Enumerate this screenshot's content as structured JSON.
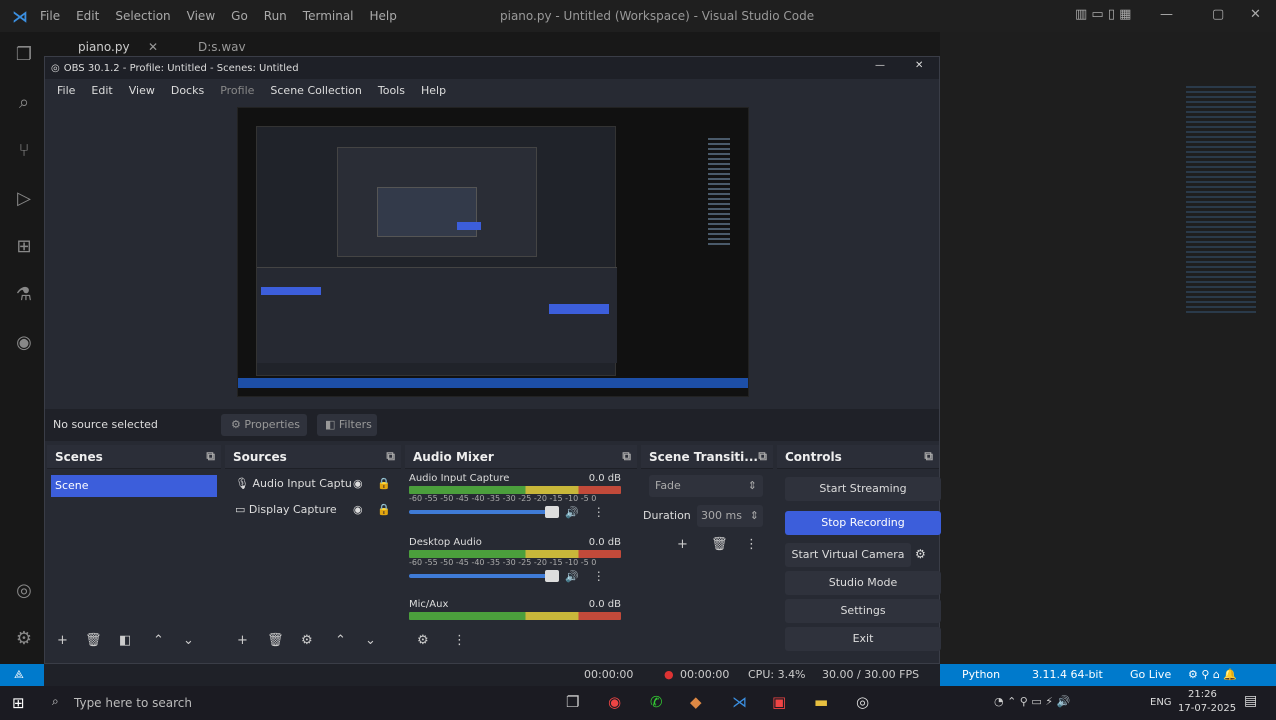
{
  "vscode": {
    "menu": [
      "File",
      "Edit",
      "Selection",
      "View",
      "Go",
      "Run",
      "Terminal",
      "Help"
    ],
    "window_title": "piano.py - Untitled (Workspace) - Visual Studio Code",
    "tabs": [
      "piano.py",
      "D:s.wav"
    ],
    "status": {
      "python": "Python",
      "interpreter": "3.11.4 64-bit",
      "go_live": "Go Live"
    }
  },
  "obs": {
    "title": "OBS 30.1.2 - Profile: Untitled - Scenes: Untitled",
    "menu": [
      "File",
      "Edit",
      "View",
      "Docks",
      "Profile",
      "Scene Collection",
      "Tools",
      "Help"
    ],
    "no_source": "No source selected",
    "properties": "Properties",
    "filters": "Filters",
    "docks": {
      "scenes": {
        "title": "Scenes",
        "items": [
          "Scene"
        ]
      },
      "sources": {
        "title": "Sources",
        "items": [
          "Audio Input Captu",
          "Display Capture"
        ]
      },
      "mixer": {
        "title": "Audio Mixer",
        "channels": [
          {
            "name": "Audio Input Capture",
            "db": "0.0 dB"
          },
          {
            "name": "Desktop Audio",
            "db": "0.0 dB"
          },
          {
            "name": "Mic/Aux",
            "db": "0.0 dB"
          }
        ],
        "ticks": "-60 -55 -50 -45 -40 -35 -30 -25 -20 -15 -10 -5 0"
      },
      "transitions": {
        "title": "Scene Transiti...",
        "type": "Fade",
        "duration_label": "Duration",
        "duration": "300 ms"
      },
      "controls": {
        "title": "Controls",
        "buttons": [
          "Start Streaming",
          "Stop Recording",
          "Start Virtual Camera",
          "Studio Mode",
          "Settings",
          "Exit"
        ]
      }
    },
    "status": {
      "live": "00:00:00",
      "rec": "00:00:00",
      "cpu": "CPU: 3.4%",
      "fps": "30.00 / 30.00 FPS"
    }
  },
  "taskbar": {
    "search_placeholder": "Type here to search",
    "lang": "ENG",
    "time": "21:26",
    "date": "17-07-2025"
  },
  "colors": {
    "accent": "#3c5edb",
    "status_blue": "#007acc"
  }
}
